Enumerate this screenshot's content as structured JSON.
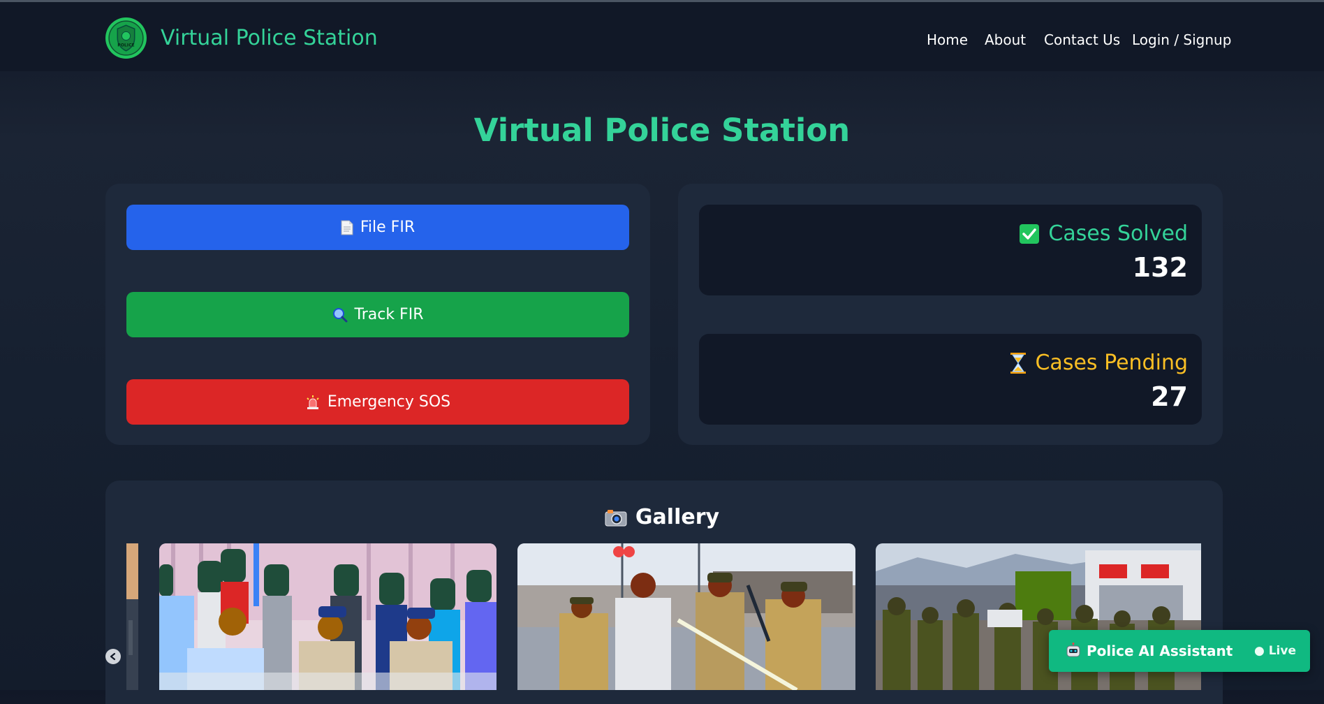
{
  "nav": {
    "brand": "Virtual Police Station",
    "links": [
      "Home",
      "About",
      "Contact Us",
      "Login / Signup"
    ],
    "logo_text": "POLICE"
  },
  "hero": {
    "title": "Virtual Police Station"
  },
  "actions": [
    {
      "label": "File FIR",
      "icon": "document-icon",
      "color": "#2563eb"
    },
    {
      "label": "Track FIR",
      "icon": "magnifier-icon",
      "color": "#16a34a"
    },
    {
      "label": "Emergency SOS",
      "icon": "siren-icon",
      "color": "#dc2626"
    }
  ],
  "stats": {
    "solved": {
      "label": "Cases Solved",
      "value": "132",
      "icon": "checkbox-icon",
      "color": "#34d399"
    },
    "pending": {
      "label": "Cases Pending",
      "value": "27",
      "icon": "hourglass-icon",
      "color": "#fbbf24"
    }
  },
  "gallery": {
    "title": "Gallery",
    "icon": "camera-icon",
    "photos": [
      "photo-press-conference",
      "photo-street-scuffle",
      "photo-riot-police"
    ]
  },
  "assistant": {
    "title": "Police AI Assistant",
    "status": "● Live",
    "icon": "robot-icon"
  },
  "colors": {
    "accent": "#34d399",
    "bg": "#111827",
    "panel": "#1e293b"
  }
}
